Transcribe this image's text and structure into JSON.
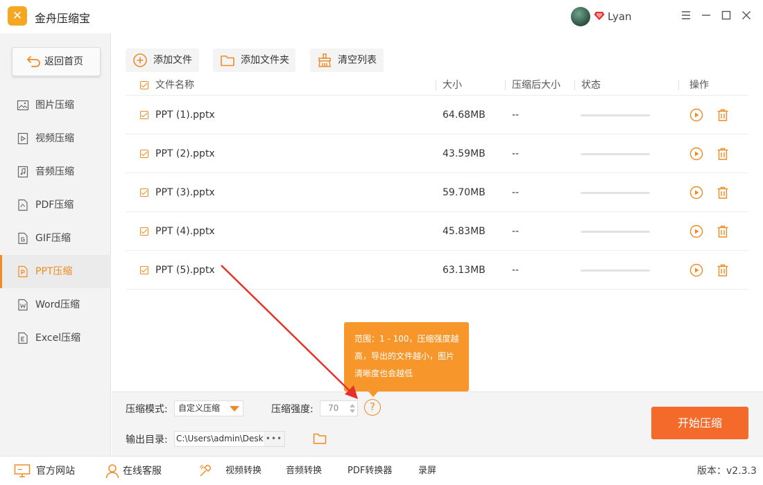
{
  "app": {
    "title": "金舟压缩宝",
    "logo_glyph": "✕"
  },
  "user": {
    "name": "Lyan"
  },
  "sidebar": {
    "back_label": "返回首页",
    "items": [
      {
        "label": "图片压缩",
        "icon": "image-icon"
      },
      {
        "label": "视频压缩",
        "icon": "video-icon"
      },
      {
        "label": "音频压缩",
        "icon": "audio-icon"
      },
      {
        "label": "PDF压缩",
        "icon": "pdf-icon"
      },
      {
        "label": "GIF压缩",
        "icon": "gif-icon"
      },
      {
        "label": "PPT压缩",
        "icon": "ppt-icon",
        "active": true
      },
      {
        "label": "Word压缩",
        "icon": "word-icon"
      },
      {
        "label": "Excel压缩",
        "icon": "excel-icon"
      }
    ]
  },
  "toolbar": {
    "add_file": "添加文件",
    "add_folder": "添加文件夹",
    "clear_list": "清空列表"
  },
  "table": {
    "headers": {
      "name": "文件名称",
      "size": "大小",
      "compressed_size": "压缩后大小",
      "status": "状态",
      "actions": "操作"
    },
    "rows": [
      {
        "name": "PPT (1).pptx",
        "size": "64.68MB",
        "compressed": "--"
      },
      {
        "name": "PPT (2).pptx",
        "size": "43.59MB",
        "compressed": "--"
      },
      {
        "name": "PPT (3).pptx",
        "size": "59.70MB",
        "compressed": "--"
      },
      {
        "name": "PPT (4).pptx",
        "size": "45.83MB",
        "compressed": "--"
      },
      {
        "name": "PPT (5).pptx",
        "size": "63.13MB",
        "compressed": "--"
      }
    ]
  },
  "settings": {
    "mode_label": "压缩模式:",
    "mode_value": "自定义压缩",
    "strength_label": "压缩强度:",
    "strength_value": "70",
    "help_glyph": "?",
    "output_label": "输出目录:",
    "output_path": "C:\\Users\\admin\\Desktop\\金",
    "dots": "•••",
    "start_label": "开始压缩"
  },
  "tooltip": {
    "line1": "范围：1 - 100，压缩强度越",
    "line2": "高，导出的文件越小，图片",
    "line3": "清晰度也会越低"
  },
  "footer": {
    "website": "官方网站",
    "support": "在线客服",
    "video_convert": "视频转换",
    "audio_convert": "音频转换",
    "pdf_convert": "PDF转换器",
    "record": "录屏",
    "version": "版本：v2.3.3"
  },
  "colors": {
    "accent": "#f08a24",
    "start_button": "#f46a2a",
    "tooltip": "#f7962b",
    "arrow": "#e8302a"
  }
}
